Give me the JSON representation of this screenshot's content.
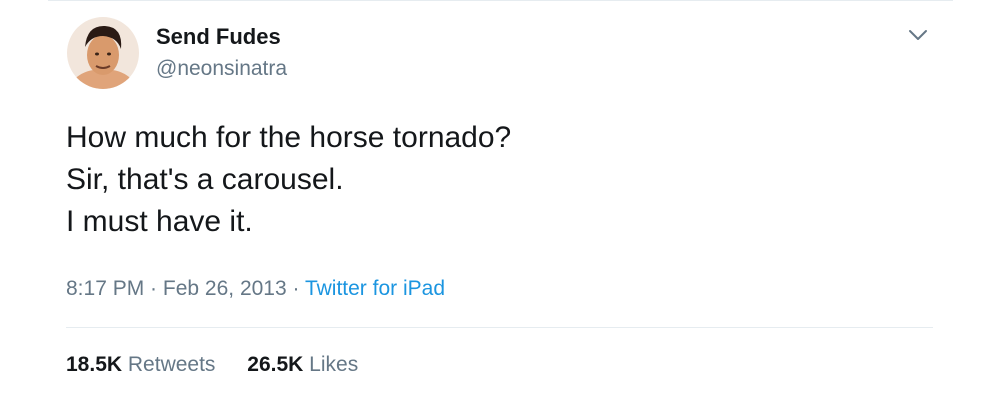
{
  "author": {
    "display_name": "Send Fudes",
    "handle": "@neonsinatra"
  },
  "tweet": {
    "lines": [
      "How much for the horse tornado?",
      "Sir, that's a carousel.",
      "I must have it."
    ]
  },
  "meta": {
    "time": "8:17 PM",
    "separator": " · ",
    "date": "Feb 26, 2013",
    "source": "Twitter for iPad"
  },
  "stats": {
    "retweets_count": "18.5K",
    "retweets_label": "Retweets",
    "likes_count": "26.5K",
    "likes_label": "Likes"
  },
  "icons": {
    "more": "chevron-down-icon"
  },
  "colors": {
    "text": "#14171a",
    "secondary": "#657786",
    "link": "#1b95e0",
    "divider": "#e6ecf0"
  }
}
